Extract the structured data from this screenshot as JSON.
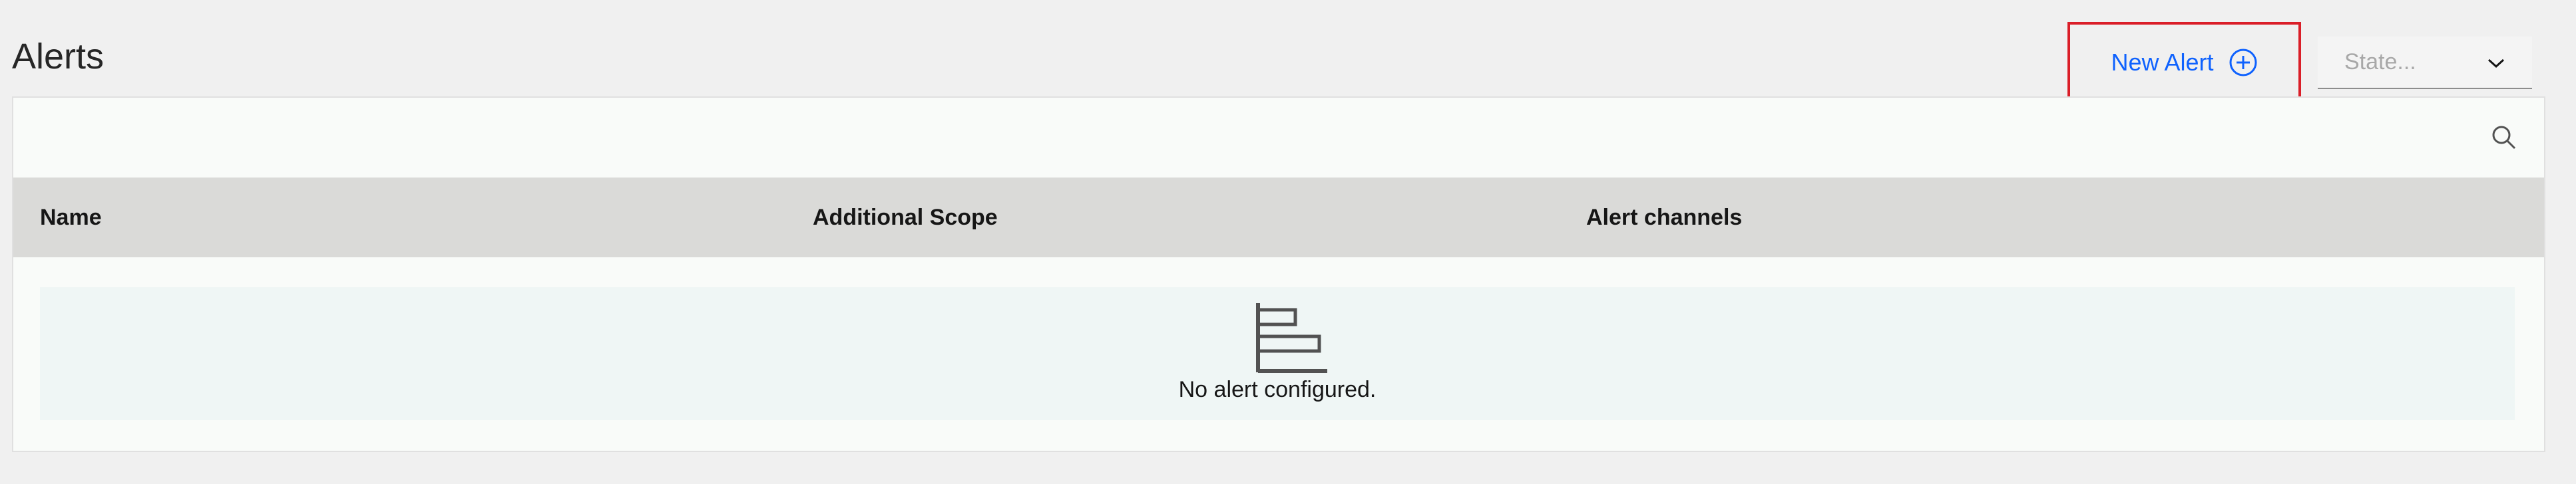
{
  "page": {
    "title": "Alerts"
  },
  "toolbar": {
    "new_alert_label": "New Alert",
    "new_alert_icon": "add-circle-icon",
    "state_placeholder": "State...",
    "state_icon": "chevron-down-icon",
    "search_icon": "search-icon"
  },
  "table": {
    "columns": [
      {
        "label": "Name"
      },
      {
        "label": "Additional Scope"
      },
      {
        "label": "Alert channels"
      }
    ],
    "empty_icon": "empty-chart-icon",
    "empty_text": "No alert configured."
  },
  "colors": {
    "accent": "#0f62fe",
    "highlight_border": "#da1e28"
  }
}
